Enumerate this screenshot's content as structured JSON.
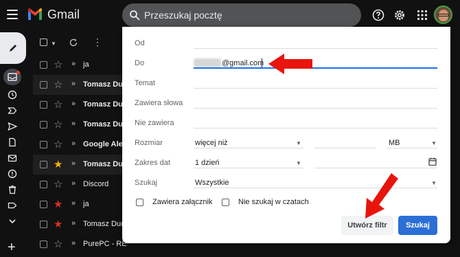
{
  "app": {
    "name": "Gmail"
  },
  "search": {
    "placeholder": "Przeszukaj pocztę"
  },
  "toolbar": {
    "help_icon": "help-icon",
    "settings_icon": "gear-icon",
    "apps_icon": "apps-grid-icon"
  },
  "colors": {
    "background": "#111111",
    "search_bg": "#525355",
    "accent_blue": "#2b6fd6",
    "annotation_red": "#e8150d",
    "star_yellow": "#f4b400",
    "star_red": "#d93025"
  },
  "emails": [
    {
      "sender": "ja",
      "bold": false,
      "read": false,
      "star": "none"
    },
    {
      "sender": "Tomasz Dud",
      "bold": true,
      "read": true,
      "star": "none"
    },
    {
      "sender": "Tomasz Dud",
      "bold": true,
      "read": false,
      "star": "none"
    },
    {
      "sender": "Tomasz Dud",
      "bold": true,
      "read": false,
      "star": "none"
    },
    {
      "sender": "Google Aler",
      "bold": true,
      "read": false,
      "star": "none"
    },
    {
      "sender": "Tomasz Dud",
      "bold": true,
      "read": true,
      "star": "yellow"
    },
    {
      "sender": "Discord",
      "bold": false,
      "read": false,
      "star": "none"
    },
    {
      "sender": "ja",
      "bold": false,
      "read": false,
      "star": "red"
    },
    {
      "sender": "Tomasz Dud",
      "bold": false,
      "read": false,
      "star": "red"
    },
    {
      "sender": "PurePC - RE",
      "bold": false,
      "read": false,
      "star": "none"
    }
  ],
  "filter": {
    "from_label": "Od",
    "to_label": "Do",
    "to_value": "@gmail.com",
    "subject_label": "Temat",
    "has_words_label": "Zawiera słowa",
    "not_has_label": "Nie zawiera",
    "size_label": "Rozmiar",
    "size_operator": "więcej niż",
    "size_unit": "MB",
    "date_label": "Zakres dat",
    "date_value": "1 dzień",
    "search_in_label": "Szukaj",
    "search_in_value": "Wszystkie",
    "has_attachment_label": "Zawiera załącznik",
    "no_chats_label": "Nie szukaj w czatach",
    "create_filter_label": "Utwórz filtr",
    "search_button_label": "Szukaj"
  }
}
